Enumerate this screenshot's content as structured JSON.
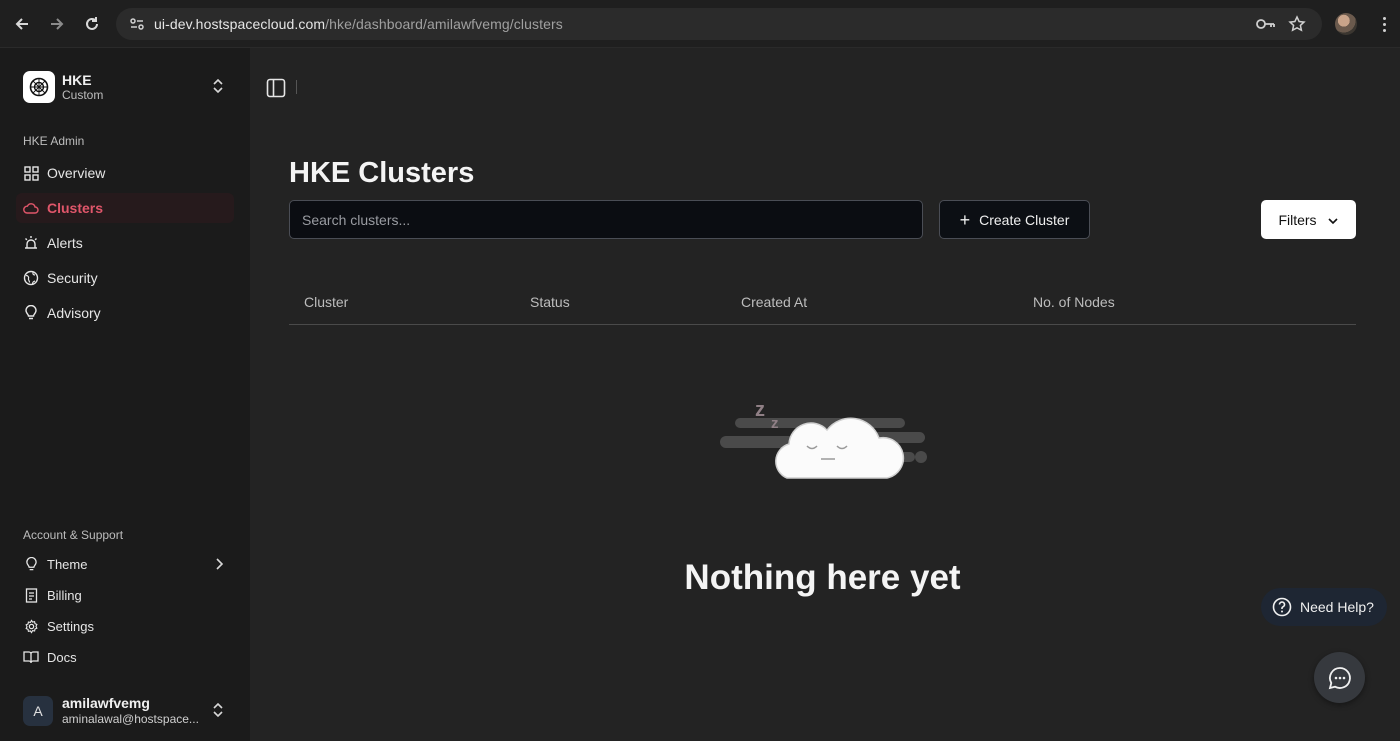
{
  "browser": {
    "url_host": "ui-dev.hostspacecloud.com",
    "url_path": "/hke/dashboard/amilawfvemg/clusters"
  },
  "sidebar": {
    "org_name": "HKE",
    "org_sub": "Custom",
    "admin_section": "HKE Admin",
    "nav": [
      {
        "label": "Overview",
        "icon": "grid-icon"
      },
      {
        "label": "Clusters",
        "icon": "cloud-icon",
        "active": true
      },
      {
        "label": "Alerts",
        "icon": "siren-icon"
      },
      {
        "label": "Security",
        "icon": "globe-icon"
      },
      {
        "label": "Advisory",
        "icon": "lightbulb-icon"
      }
    ],
    "account_section": "Account & Support",
    "account_nav": [
      {
        "label": "Theme",
        "icon": "lightbulb-icon"
      },
      {
        "label": "Billing",
        "icon": "receipt-icon"
      },
      {
        "label": "Settings",
        "icon": "gear-icon"
      },
      {
        "label": "Docs",
        "icon": "book-icon"
      }
    ],
    "user": {
      "initial": "A",
      "name": "amilawfvemg",
      "email": "aminalawal@hostspace..."
    }
  },
  "main": {
    "title": "HKE Clusters",
    "search_placeholder": "Search clusters...",
    "create_label": "Create Cluster",
    "filters_label": "Filters",
    "columns": [
      "Cluster",
      "Status",
      "Created At",
      "No. of Nodes"
    ],
    "empty_text": "Nothing here yet",
    "help_label": "Need Help?"
  },
  "colors": {
    "accent": "#e0566a",
    "background": "#232323",
    "sidebar": "#1b1b1b"
  }
}
